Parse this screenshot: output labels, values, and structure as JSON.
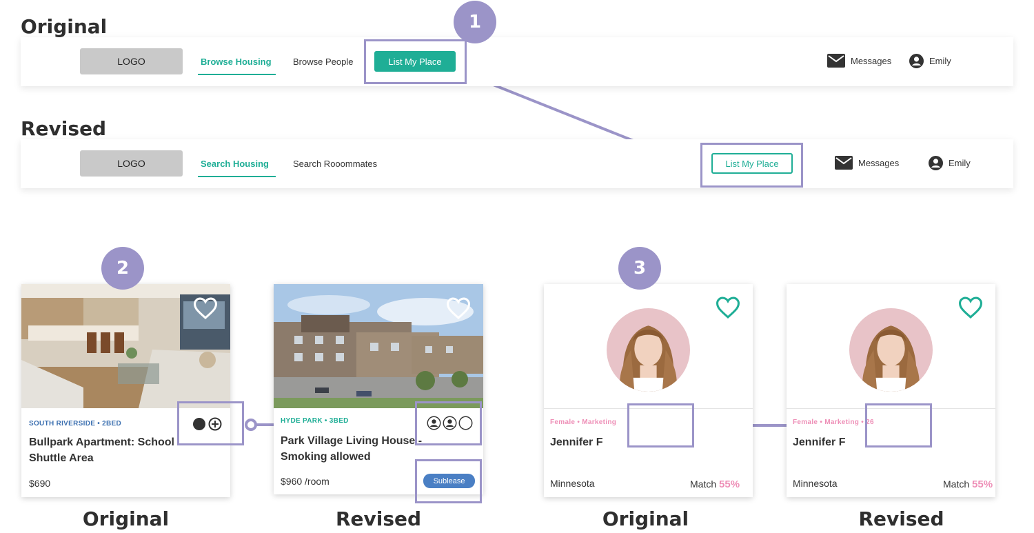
{
  "headings": {
    "original": "Original",
    "revised": "Revised"
  },
  "nav_original": {
    "logo": "LOGO",
    "link_active": "Browse Housing",
    "link_2": "Browse People",
    "cta": "List My Place",
    "messages": "Messages",
    "user": "Emily"
  },
  "nav_revised": {
    "logo": "LOGO",
    "link_active": "Search Housing",
    "link_2": "Search Rooommates",
    "cta": "List My Place",
    "messages": "Messages",
    "user": "Emily"
  },
  "badges": [
    "1",
    "2",
    "3"
  ],
  "housing_original": {
    "meta": "SOUTH RIVERSIDE • 2BED",
    "title": "Bullpark Apartment: School Shuttle Area",
    "price": "$690"
  },
  "housing_revised": {
    "meta": "HYDE PARK • 3BED",
    "title": "Park Village Living House - Smoking allowed",
    "price": "$960 /room",
    "tag": "Sublease"
  },
  "person_original": {
    "meta": "Female • Marketing",
    "name": "Jennifer F",
    "location": "Minnesota",
    "match_label": "Match",
    "match_value": "55%"
  },
  "person_revised": {
    "meta_a": "Female • Marketing",
    "meta_b": "• 26",
    "name": "Jennifer F",
    "location": "Minnesota",
    "match_label": "Match",
    "match_value": "55%"
  },
  "captions": [
    "Original",
    "Revised",
    "Original",
    "Revised"
  ],
  "colors": {
    "teal": "#1fae96",
    "annotation": "#9b94c8",
    "pink": "#ee8fb7",
    "blue_meta": "#3b6fb0",
    "pill": "#4a7fc4"
  },
  "icons": [
    "envelope-icon",
    "user-circle-icon",
    "heart-icon",
    "dot-icon",
    "plus-circle-icon",
    "person-slot-icon"
  ]
}
